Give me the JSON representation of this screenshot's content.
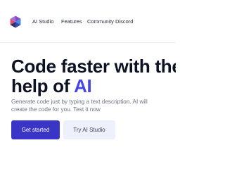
{
  "nav": {
    "links": [
      {
        "label": "AI Studio"
      },
      {
        "label": "Features"
      },
      {
        "label": "Community Discord"
      }
    ]
  },
  "hero": {
    "headline_line1": "Code faster with the",
    "headline_line2_prefix": "help of ",
    "headline_line2_accent": "AI",
    "subtitle_line1": "Generate code just by typing a text description. AI will",
    "subtitle_line2": "create the code for you. Test it now",
    "primary_button": "Get started",
    "secondary_button": "Try AI Studio"
  },
  "colors": {
    "accent": "#4a46e5",
    "primary_button_bg": "#3b35c7",
    "secondary_button_bg": "#eef0fc",
    "logo": [
      "#7c4dcc",
      "#4a8fe0",
      "#e0506e",
      "#2a2f6e"
    ]
  },
  "icons": {
    "logo": "cube-logo-icon"
  }
}
